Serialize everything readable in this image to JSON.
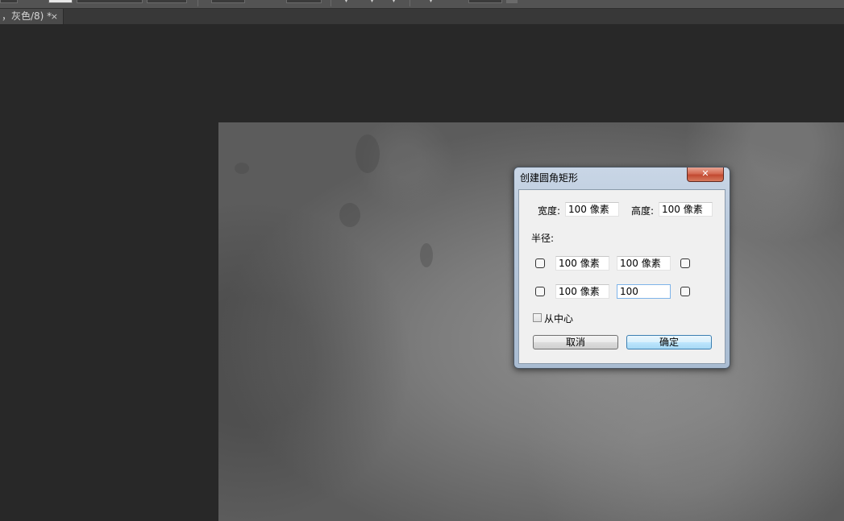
{
  "document_tab": {
    "title": "，灰色/8) *",
    "close_glyph": "×"
  },
  "dialog": {
    "title": "创建圆角矩形",
    "close_glyph": "✕",
    "width_label": "宽度:",
    "width_value": "100 像素",
    "height_label": "高度:",
    "height_value": "100 像素",
    "radius_label": "半径:",
    "radius_top_left": "100 像素",
    "radius_top_right": "100 像素",
    "radius_bottom_left": "100 像素",
    "radius_bottom_right": "100",
    "from_center_label": "从中心",
    "from_center_checked": false,
    "cancel_label": "取消",
    "ok_label": "确定"
  },
  "colors": {
    "workspace_bg": "#282828",
    "dialog_frame": "#b9c9dc",
    "close_button": "#c24a31",
    "default_button_border": "#3c7fb1"
  }
}
